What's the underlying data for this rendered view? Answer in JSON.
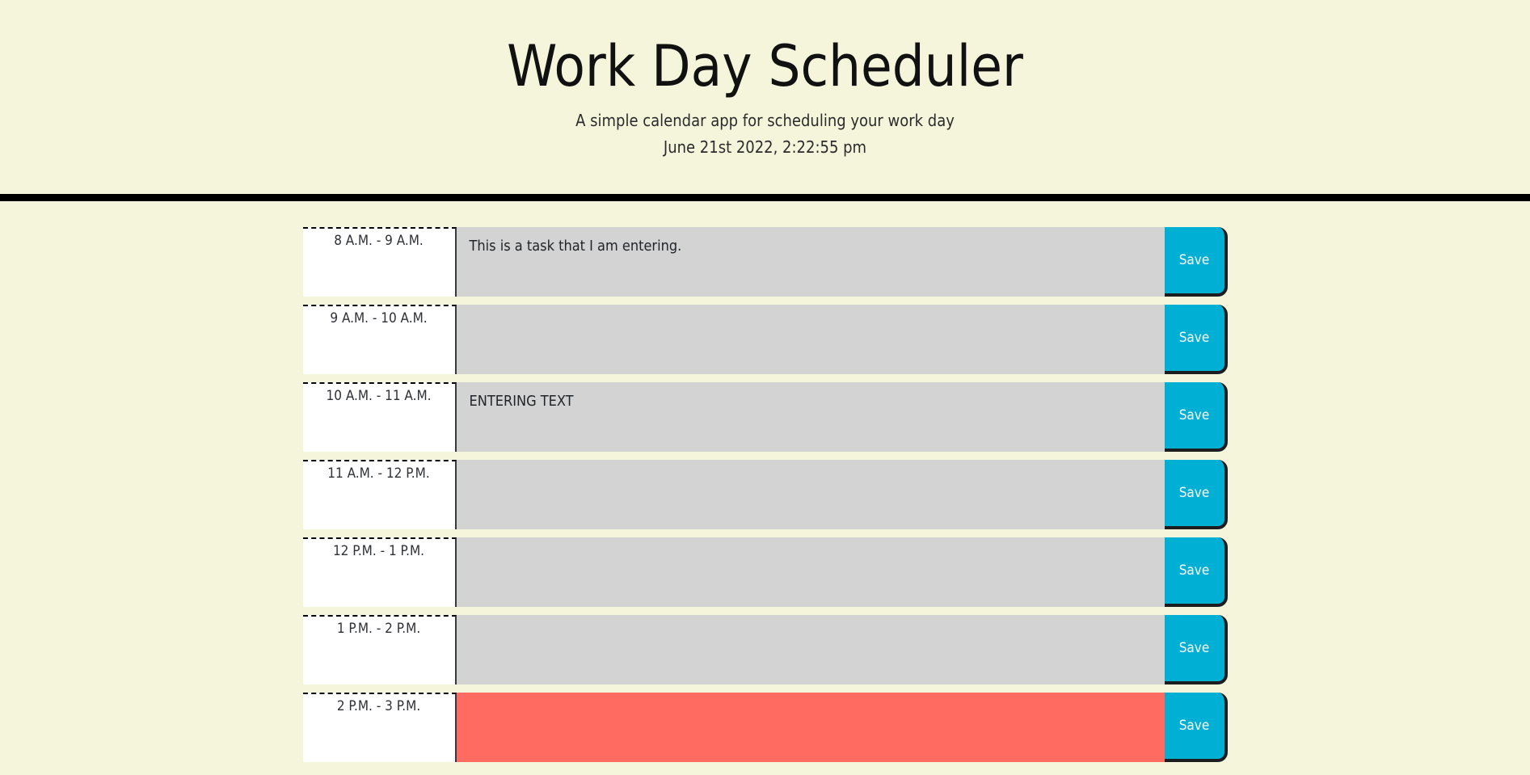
{
  "header": {
    "title": "Work Day Scheduler",
    "subtitle": "A simple calendar app for scheduling your work day",
    "current_day": "June 21st 2022, 2:22:55 pm"
  },
  "colors": {
    "page_background": "#f5f5dc",
    "divider": "#000000",
    "hour_cell": "#ffffff",
    "textarea_past": "#d3d3d3",
    "textarea_present": "#ff6b61",
    "textarea_future": "#d3d3d3",
    "save_button": "#00b0d4",
    "save_button_text": "#ffffff",
    "save_button_border": "#1b1d1f"
  },
  "scheduler": {
    "save_label": "Save",
    "placeholder": "",
    "blocks": [
      {
        "id": "hour-8",
        "time_label": "8 A.M. - 9 A.M.",
        "task": "This is a task that I am entering.",
        "state": "past"
      },
      {
        "id": "hour-9",
        "time_label": "9 A.M. - 10 A.M.",
        "task": "",
        "state": "past"
      },
      {
        "id": "hour-10",
        "time_label": "10 A.M. - 11 A.M.",
        "task": "ENTERING TEXT",
        "state": "past"
      },
      {
        "id": "hour-11",
        "time_label": "11 A.M. - 12 P.M.",
        "task": "",
        "state": "past"
      },
      {
        "id": "hour-12",
        "time_label": "12 P.M. - 1 P.M.",
        "task": "",
        "state": "past"
      },
      {
        "id": "hour-13",
        "time_label": "1 P.M. - 2 P.M.",
        "task": "",
        "state": "past"
      },
      {
        "id": "hour-14",
        "time_label": "2 P.M. - 3 P.M.",
        "task": "",
        "state": "present"
      }
    ]
  }
}
